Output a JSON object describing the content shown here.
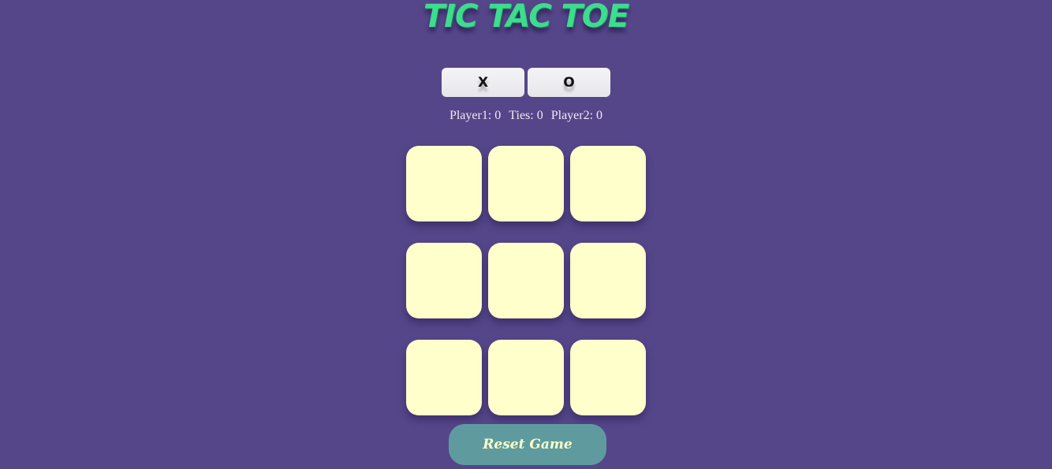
{
  "title": "TIC TAC TOE",
  "player_select": {
    "x_label": "X",
    "o_label": "O"
  },
  "scoreboard": {
    "player1": "Player1: 0",
    "ties": "Ties: 0",
    "player2": "Player2: 0"
  },
  "board": {
    "cells": [
      "",
      "",
      "",
      "",
      "",
      "",
      "",
      "",
      ""
    ]
  },
  "reset_label": "Reset Game",
  "colors": {
    "background": "#55468a",
    "title": "#3ddc8e",
    "cell": "#ffffcb",
    "reset_button": "#5f9b9e"
  }
}
